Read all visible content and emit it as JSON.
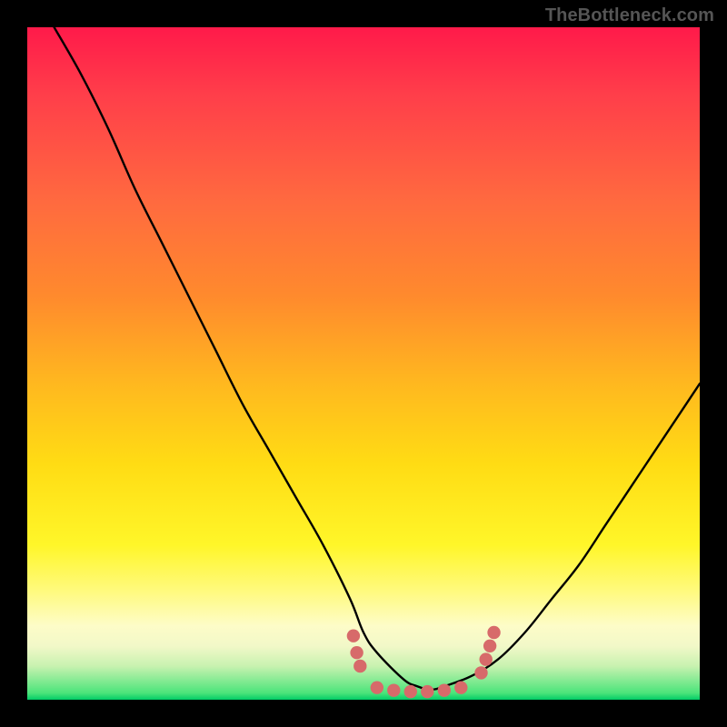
{
  "watermark": "TheBottleneck.com",
  "colors": {
    "curve_stroke": "#000000",
    "marker_fill": "#d76a6a",
    "marker_stroke": "#d76a6a",
    "frame": "#000000"
  },
  "chart_data": {
    "type": "line",
    "title": "",
    "xlabel": "",
    "ylabel": "",
    "xlim": [
      0,
      100
    ],
    "ylim": [
      0,
      100
    ],
    "grid": false,
    "legend": false,
    "series": [
      {
        "name": "bottleneck-curve",
        "x": [
          4,
          8,
          12,
          16,
          20,
          24,
          28,
          32,
          36,
          40,
          44,
          48,
          50,
          52,
          56,
          58,
          60,
          62,
          66,
          70,
          74,
          78,
          82,
          86,
          90,
          94,
          98,
          100
        ],
        "y": [
          100,
          93,
          85,
          76,
          68,
          60,
          52,
          44,
          37,
          30,
          23,
          15,
          10,
          7,
          3,
          2,
          1.5,
          2,
          3.5,
          6,
          10,
          15,
          20,
          26,
          32,
          38,
          44,
          47
        ]
      }
    ],
    "markers": [
      {
        "x": 48.5,
        "y": 9.5
      },
      {
        "x": 49.0,
        "y": 7.0
      },
      {
        "x": 49.5,
        "y": 5.0
      },
      {
        "x": 52.0,
        "y": 1.8
      },
      {
        "x": 54.5,
        "y": 1.4
      },
      {
        "x": 57.0,
        "y": 1.2
      },
      {
        "x": 59.5,
        "y": 1.2
      },
      {
        "x": 62.0,
        "y": 1.4
      },
      {
        "x": 64.5,
        "y": 1.8
      },
      {
        "x": 67.5,
        "y": 4.0
      },
      {
        "x": 68.2,
        "y": 6.0
      },
      {
        "x": 68.8,
        "y": 8.0
      },
      {
        "x": 69.4,
        "y": 10.0
      }
    ]
  }
}
